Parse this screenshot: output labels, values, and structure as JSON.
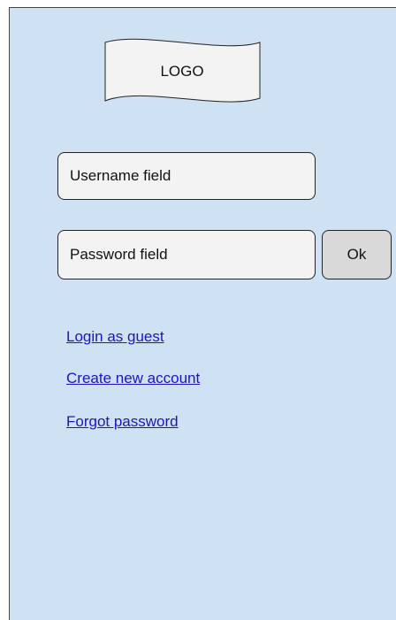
{
  "logo": {
    "label": "LOGO"
  },
  "form": {
    "username_placeholder": "Username field",
    "password_placeholder": "Password field",
    "ok_label": "Ok"
  },
  "links": {
    "guest": "Login as guest",
    "create_account": "Create new account",
    "forgot_password": "Forgot password"
  },
  "colors": {
    "background": "#cfe2f3",
    "field": "#f3f3f3",
    "button": "#d9d9d9",
    "link": "#1a15c4"
  }
}
